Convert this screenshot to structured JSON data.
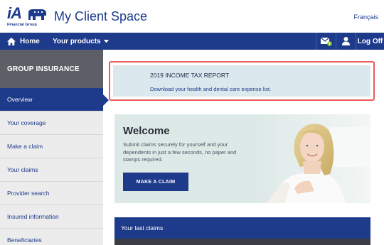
{
  "header": {
    "logo_text": "iA",
    "logo_subtext": "Financial Group",
    "app_title": "My Client Space",
    "language_link": "Français"
  },
  "navbar": {
    "home_label": "Home",
    "products_label": "Your products",
    "logoff_label": "Log Off"
  },
  "sidebar": {
    "header": "GROUP INSURANCE",
    "items": [
      {
        "label": "Overview",
        "active": true
      },
      {
        "label": "Your coverage"
      },
      {
        "label": "Make a claim"
      },
      {
        "label": "Your claims"
      },
      {
        "label": "Provider search"
      },
      {
        "label": "Insured information"
      },
      {
        "label": "Beneficiaries"
      }
    ]
  },
  "notice": {
    "title": "2019 INCOME TAX REPORT",
    "link": "Download your health and dental care expense list."
  },
  "welcome": {
    "title": "Welcome",
    "text": "Submit claims securely for yourself and your dependents in just a few seconds, no paper and stamps required.",
    "button": "MAKE A CLAIM"
  },
  "last_claims": {
    "title": "Your last claims"
  },
  "colors": {
    "brand_blue": "#1e3a8a",
    "sidebar_header": "#5c6066",
    "notice_border": "#ec5a5a",
    "notice_bg": "#dbe8ee"
  }
}
